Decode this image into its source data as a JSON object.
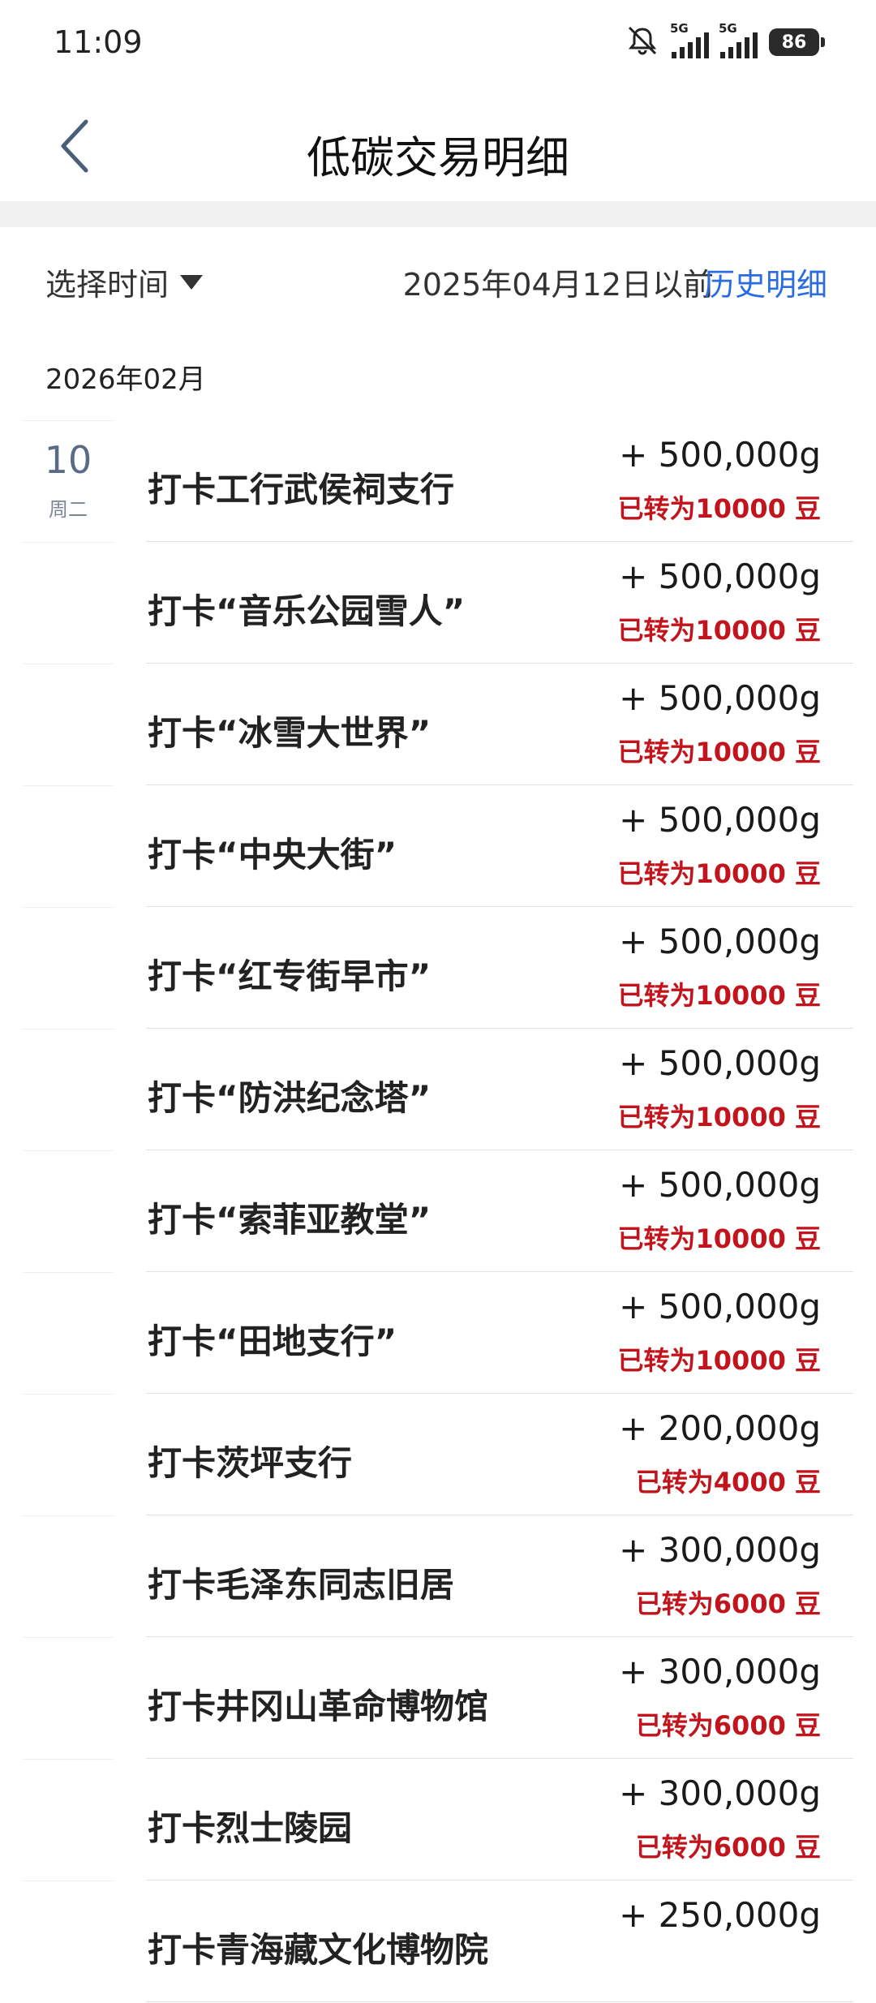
{
  "status": {
    "time": "11:09",
    "net1": "5G",
    "net2": "5G",
    "battery": "86"
  },
  "header": {
    "title": "低碳交易明细"
  },
  "filter": {
    "select_label": "选择时间",
    "before_text": "2025年04月12日以前",
    "history_link": "历史明细"
  },
  "month": "2026年02月",
  "date": {
    "day": "10",
    "weekday": "周二"
  },
  "items": [
    {
      "title": "打卡工行武侯祠支行",
      "amount": "+ 500,000g",
      "converted": "已转为10000 豆"
    },
    {
      "title": "打卡“音乐公园雪人”",
      "amount": "+ 500,000g",
      "converted": "已转为10000 豆"
    },
    {
      "title": "打卡“冰雪大世界”",
      "amount": "+ 500,000g",
      "converted": "已转为10000 豆"
    },
    {
      "title": "打卡“中央大街”",
      "amount": "+ 500,000g",
      "converted": "已转为10000 豆"
    },
    {
      "title": "打卡“红专街早市”",
      "amount": "+ 500,000g",
      "converted": "已转为10000 豆"
    },
    {
      "title": "打卡“防洪纪念塔”",
      "amount": "+ 500,000g",
      "converted": "已转为10000 豆"
    },
    {
      "title": "打卡“索菲亚教堂”",
      "amount": "+ 500,000g",
      "converted": "已转为10000 豆"
    },
    {
      "title": "打卡“田地支行”",
      "amount": "+ 500,000g",
      "converted": "已转为10000 豆"
    },
    {
      "title": "打卡茨坪支行",
      "amount": "+ 200,000g",
      "converted": "已转为4000 豆"
    },
    {
      "title": "打卡毛泽东同志旧居",
      "amount": "+ 300,000g",
      "converted": "已转为6000 豆"
    },
    {
      "title": "打卡井冈山革命博物馆",
      "amount": "+ 300,000g",
      "converted": "已转为6000 豆"
    },
    {
      "title": "打卡烈士陵园",
      "amount": "+ 300,000g",
      "converted": "已转为6000 豆"
    },
    {
      "title": "打卡青海藏文化博物院",
      "amount": "+ 250,000g",
      "converted": ""
    }
  ]
}
